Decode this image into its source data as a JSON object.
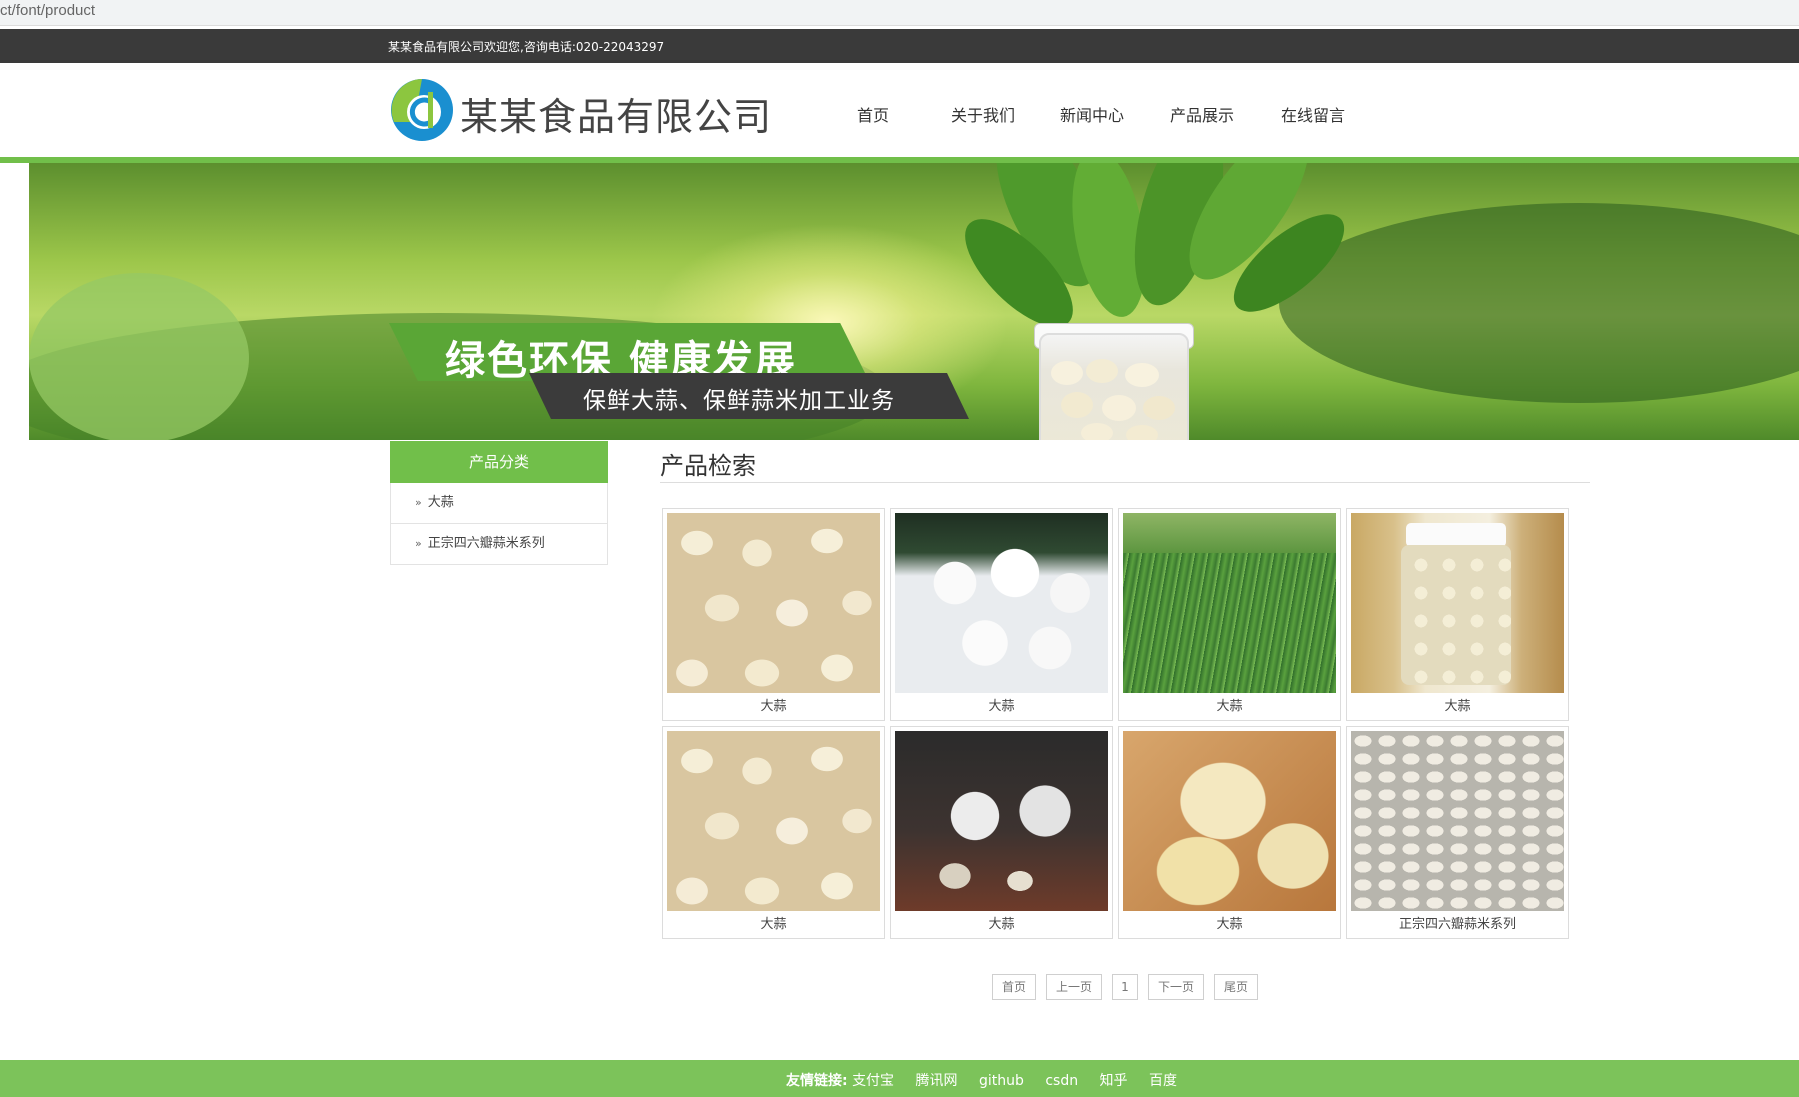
{
  "browser": {
    "url_fragment": "ct/font/product"
  },
  "topbar": {
    "welcome_text": "某某食品有限公司欢迎您,咨询电话:020-22043297"
  },
  "header": {
    "company_name": "某某食品有限公司",
    "nav": [
      {
        "label": "首页"
      },
      {
        "label": "关于我们"
      },
      {
        "label": "新闻中心"
      },
      {
        "label": "产品展示"
      },
      {
        "label": "在线留言"
      }
    ]
  },
  "banner": {
    "slogan_main": "绿色环保  健康发展",
    "slogan_sub": "保鲜大蒜、保鲜蒜米加工业务"
  },
  "sidebar": {
    "title": "产品分类",
    "items": [
      {
        "label": "大蒜"
      },
      {
        "label": "正宗四六瓣蒜米系列"
      }
    ]
  },
  "main": {
    "title": "产品检索",
    "products": [
      {
        "caption": "大蒜",
        "image": "peeled-garlic-cloves"
      },
      {
        "caption": "大蒜",
        "image": "garlic-bulbs"
      },
      {
        "caption": "大蒜",
        "image": "garlic-field"
      },
      {
        "caption": "大蒜",
        "image": "garlic-jar"
      },
      {
        "caption": "大蒜",
        "image": "peeled-garlic-cloves"
      },
      {
        "caption": "大蒜",
        "image": "garlic-bulbs-dark"
      },
      {
        "caption": "大蒜",
        "image": "peeled-garlic-closeup"
      },
      {
        "caption": "正宗四六瓣蒜米系列",
        "image": "garlic-cloves-in-jar"
      }
    ]
  },
  "pagination": {
    "first": "首页",
    "prev": "上一页",
    "current": "1",
    "next": "下一页",
    "last": "尾页"
  },
  "footer": {
    "label": "友情链接:",
    "links": [
      {
        "label": "支付宝"
      },
      {
        "label": "腾讯网"
      },
      {
        "label": "github"
      },
      {
        "label": "csdn"
      },
      {
        "label": "知乎"
      },
      {
        "label": "百度"
      }
    ]
  },
  "colors": {
    "accent_green": "#71bf4a",
    "topbar_dark": "#3a3a3a",
    "footer_green": "#7cc35a"
  },
  "icons": {
    "logo": "company-logo-icon",
    "sidebar_arrow": "double-chevron-right-icon"
  }
}
